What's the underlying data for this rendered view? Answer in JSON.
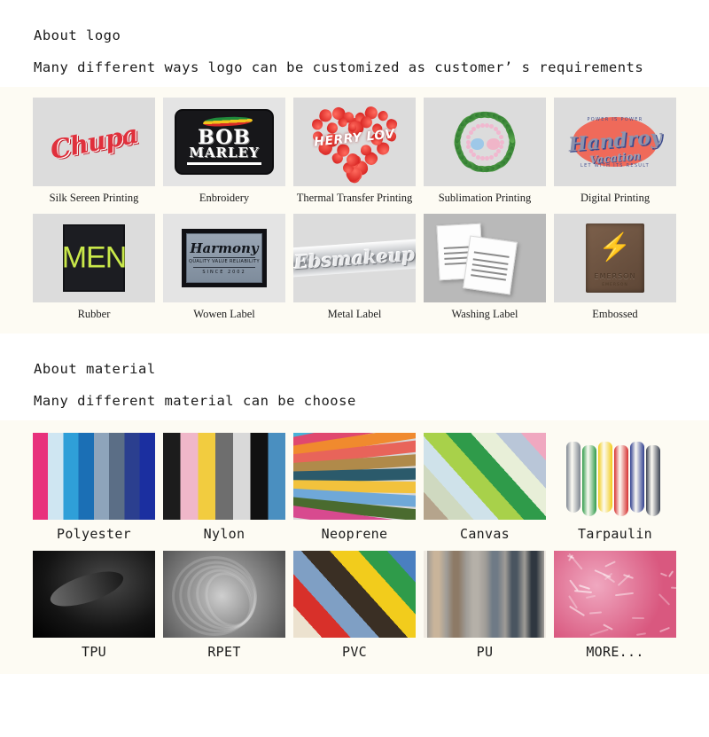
{
  "logo_section": {
    "heading": "About logo",
    "subheading": "Many different ways logo can be customized as customer’ s requirements",
    "rows": [
      [
        {
          "label": "Silk Sereen Printing",
          "art": "chupa",
          "art_text": "Chupa"
        },
        {
          "label": "Enbroidery",
          "art": "bob-marley-patch",
          "art_text": "BOB",
          "art_text2": "MARLEY"
        },
        {
          "label": "Thermal Transfer Printing",
          "art": "strawberry-heart",
          "art_text": "HERRY LOV"
        },
        {
          "label": "Sublimation Printing",
          "art": "leaf-wreath"
        },
        {
          "label": "Digital Printing",
          "art": "vintage-script-logo",
          "art_text": "Handroy",
          "art_text2": "Vacation",
          "art_text3": "POWER IS POWER",
          "art_text4": "LET WITH ITS RESULT"
        }
      ],
      [
        {
          "label": "Rubber",
          "art": "rubber-men-patch",
          "art_text": "MEN"
        },
        {
          "label": "Wowen Label",
          "art": "harmony-woven-label",
          "art_text": "Harmony",
          "art_text2": "QUALITY VALUE RELIABILITY",
          "art_text3": "SINCE 2002"
        },
        {
          "label": "Metal Label",
          "art": "metal-script-label",
          "art_text": "Ebsmakeup"
        },
        {
          "label": "Washing Label",
          "art": "care-labels"
        },
        {
          "label": "Embossed",
          "art": "leather-patch",
          "art_text": "EMERSON",
          "art_text2": "EMERSON"
        }
      ]
    ]
  },
  "material_section": {
    "heading": "About material",
    "subheading": "Many different material can be choose",
    "rows": [
      [
        {
          "label": "Polyester",
          "art": "vertical-stripe-swatch",
          "colors": [
            "#e8317c",
            "#cfe6f2",
            "#2f9fd8",
            "#1b6fb5",
            "#8ea4bb",
            "#5b6e86",
            "#2b3f8f",
            "#1b2fa0"
          ]
        },
        {
          "label": "Nylon",
          "art": "vertical-stripe-swatch",
          "colors": [
            "#1c1c1c",
            "#f0b7c9",
            "#f2cc3f",
            "#6e6e6e",
            "#d9d9d9",
            "#111111",
            "#4a8fc0"
          ]
        },
        {
          "label": "Neoprene",
          "art": "fan-sheets",
          "colors": [
            "#1f3f8f",
            "#49b3d8",
            "#e0486f",
            "#f08a2e",
            "#e8645a",
            "#b08a4a",
            "#2b5a6b",
            "#f2c23c",
            "#6fa8d8",
            "#4a6b2f",
            "#d84a8f"
          ]
        },
        {
          "label": "Canvas",
          "art": "diagonal-stripe-swatch",
          "colors": [
            "#b5a48c",
            "#cfd9c0",
            "#cfe2ea",
            "#a8d14a",
            "#2f9b4a",
            "#e8efd8",
            "#b9c6d8",
            "#f0a8c0"
          ]
        },
        {
          "label": "Tarpaulin",
          "art": "rolled-sheets",
          "colors": [
            "#7d8590",
            "#2f9b4a",
            "#f2cc1c",
            "#d63030",
            "#2f3f8f",
            "#3a4152"
          ]
        }
      ],
      [
        {
          "label": "TPU",
          "art": "glossy-black-film",
          "colors": [
            "#2a2a2a",
            "#0d0d0d"
          ]
        },
        {
          "label": "RPET",
          "art": "gray-swirled-fabric",
          "colors": [
            "#9a9a9a",
            "#5e5e5e"
          ]
        },
        {
          "label": "PVC",
          "art": "diagonal-stripe-swatch",
          "colors": [
            "#ece2cf",
            "#d8302a",
            "#7f9fc4",
            "#3a2f24",
            "#f2cc1c",
            "#2f9b4a",
            "#4a7fc0"
          ]
        },
        {
          "label": "PU",
          "art": "rolled-suede",
          "colors": [
            "#c9b49a",
            "#8d7a66",
            "#b5b0a8",
            "#6f7a86",
            "#4a5560",
            "#2f3740"
          ]
        },
        {
          "label": "MORE...",
          "art": "pink-fur",
          "colors": [
            "#f0a8c0",
            "#d9587f"
          ]
        }
      ]
    ]
  },
  "colors": {
    "page_background": "#ffffff",
    "panel_background": "#fdfbf3",
    "text": "#1b1b1b"
  }
}
